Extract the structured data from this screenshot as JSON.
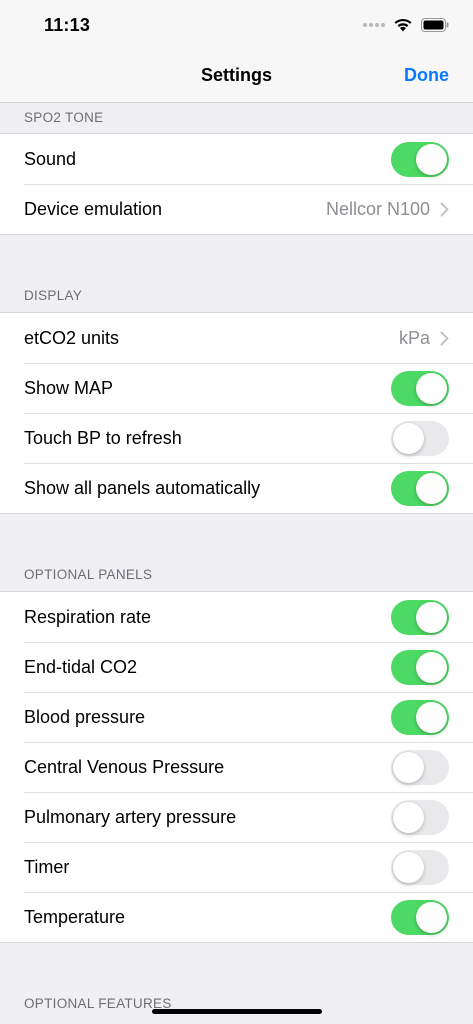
{
  "status_bar": {
    "time": "11:13"
  },
  "nav": {
    "title": "Settings",
    "done_label": "Done"
  },
  "colors": {
    "accent": "#0a7aff",
    "toggle_on": "#4cd964",
    "toggle_off": "#e9e9eb"
  },
  "sections": {
    "spo2": {
      "header": "SPO2 TONE",
      "sound": {
        "label": "Sound",
        "on": true
      },
      "device_emulation": {
        "label": "Device emulation",
        "value": "Nellcor N100"
      }
    },
    "display": {
      "header": "DISPLAY",
      "etco2_units": {
        "label": "etCO2 units",
        "value": "kPa"
      },
      "show_map": {
        "label": "Show MAP",
        "on": true
      },
      "touch_bp": {
        "label": "Touch BP to refresh",
        "on": false
      },
      "show_all_panels": {
        "label": "Show all panels automatically",
        "on": true
      }
    },
    "optional_panels": {
      "header": "OPTIONAL PANELS",
      "respiration_rate": {
        "label": "Respiration rate",
        "on": true
      },
      "end_tidal_co2": {
        "label": "End-tidal CO2",
        "on": true
      },
      "blood_pressure": {
        "label": "Blood pressure",
        "on": true
      },
      "central_venous_pressure": {
        "label": "Central Venous Pressure",
        "on": false
      },
      "pulmonary_artery_pressure": {
        "label": "Pulmonary artery pressure",
        "on": false
      },
      "timer": {
        "label": "Timer",
        "on": false
      },
      "temperature": {
        "label": "Temperature",
        "on": true
      }
    },
    "optional_features": {
      "header": "OPTIONAL FEATURES"
    }
  }
}
